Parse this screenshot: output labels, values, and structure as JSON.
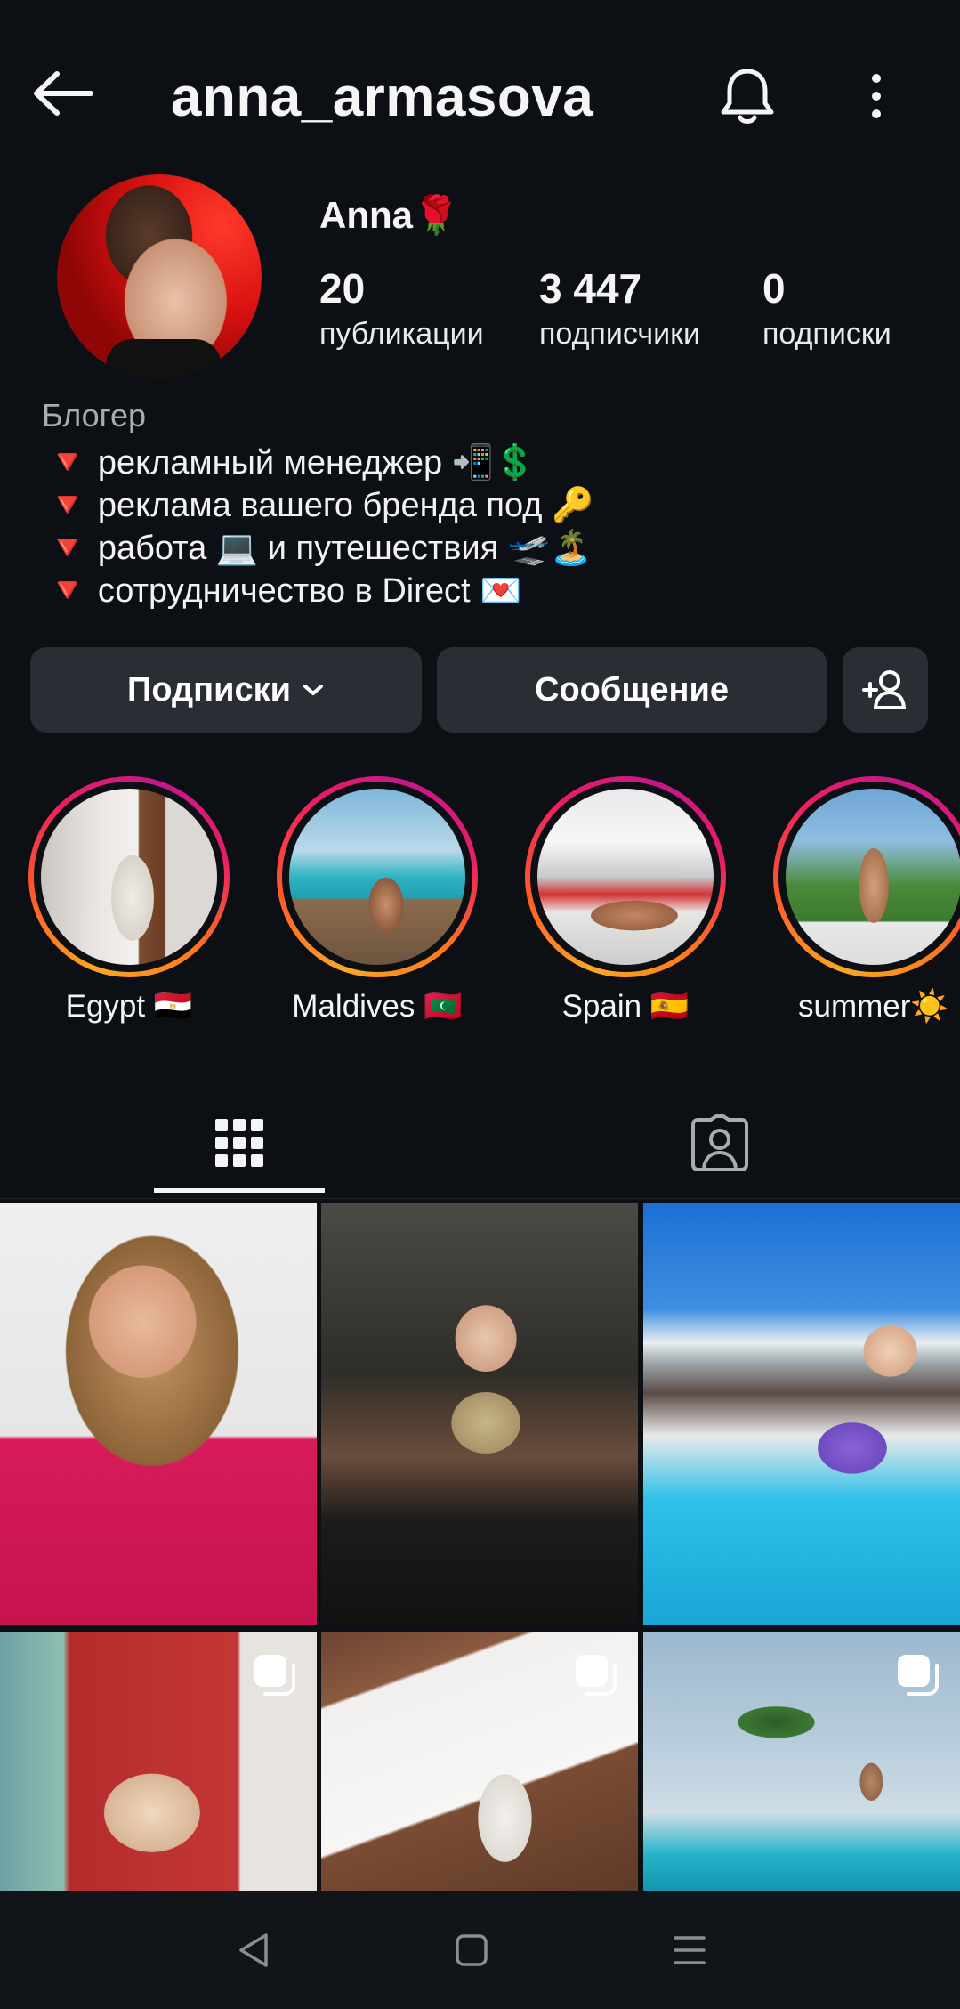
{
  "header": {
    "username": "anna_armasova"
  },
  "profile": {
    "display_name": "Anna🌹",
    "stats": [
      {
        "value": "20",
        "label": "публикации"
      },
      {
        "value": "3 447",
        "label": "подписчики"
      },
      {
        "value": "0",
        "label": "подписки"
      }
    ],
    "category": "Блогер",
    "bio": [
      "🔻 рекламный менеджер 📲💲",
      "🔻 реклама вашего бренда под 🔑",
      "🔻 работа 💻 и путешествия 🛫🏝️",
      "🔻 сотрудничество в Direct 💌"
    ]
  },
  "actions": {
    "following_label": "Подписки",
    "message_label": "Сообщение"
  },
  "highlights": [
    {
      "label": "Egypt 🇪🇬"
    },
    {
      "label": "Maldives 🇲🇻"
    },
    {
      "label": "Spain 🇪🇸"
    },
    {
      "label": "summer☀️"
    }
  ],
  "tabs": [
    {
      "name": "grid",
      "active": true
    },
    {
      "name": "tagged",
      "active": false
    }
  ],
  "colors": {
    "background": "#0c0f14",
    "button_bg": "#2a2e34",
    "text": "#f5f5f5",
    "secondary_text": "#a8abb0"
  }
}
